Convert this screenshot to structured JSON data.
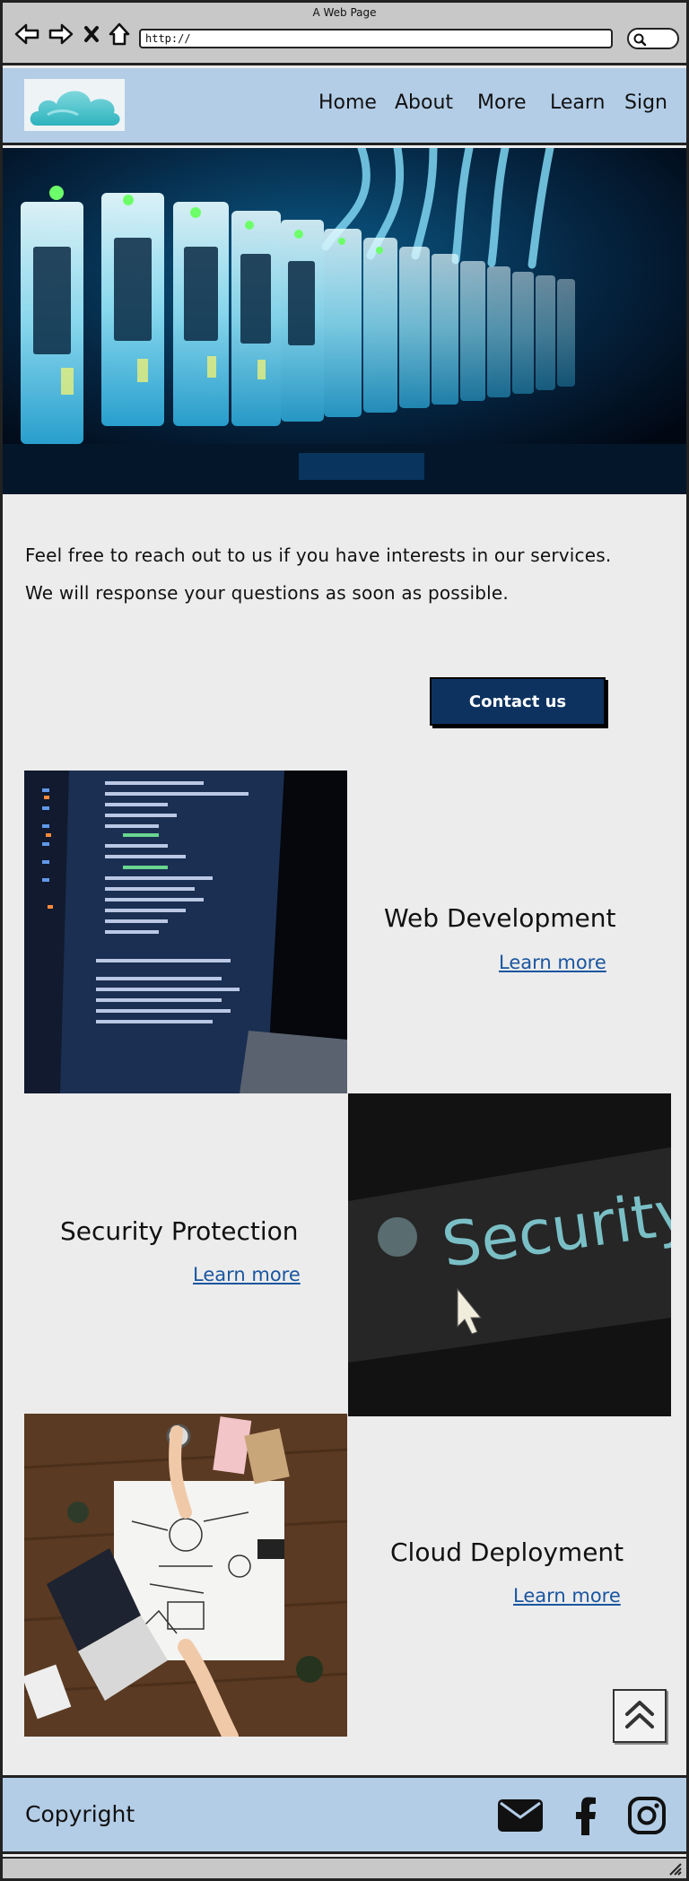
{
  "browser": {
    "title": "A Web Page",
    "url": "http://",
    "icons": [
      "back-arrow-icon",
      "forward-arrow-icon",
      "close-x-icon",
      "home-icon",
      "search-icon"
    ]
  },
  "header": {
    "logo_icon": "cloud-icon",
    "menu": [
      {
        "label": "Home"
      },
      {
        "label": "About"
      },
      {
        "label": "More"
      },
      {
        "label": "Learn"
      },
      {
        "label": "Sign"
      }
    ]
  },
  "hero": {
    "image": "server-rack-photo"
  },
  "intro": {
    "line1": "Feel free to reach out to us if you have interests in our services.",
    "line2": "We will response your questions as soon as possible."
  },
  "contact": {
    "label": "Contact us"
  },
  "services": [
    {
      "title": "Web Development",
      "link": "Learn more",
      "image": "code-on-laptop-photo"
    },
    {
      "title": "Security Protection",
      "link": "Learn more",
      "image": "security-screen-photo"
    },
    {
      "title": "Cloud Deployment",
      "link": "Learn more",
      "image": "planning-desk-photo"
    }
  ],
  "scroll_top": {
    "icon": "double-chevron-up-icon"
  },
  "footer": {
    "copyright": "Copyright",
    "social": [
      "mail-icon",
      "facebook-icon",
      "instagram-icon"
    ]
  },
  "colors": {
    "header_bg": "#b3cde6",
    "page_bg": "#ececec",
    "button_bg": "#0d3260",
    "link": "#1a56a0"
  }
}
